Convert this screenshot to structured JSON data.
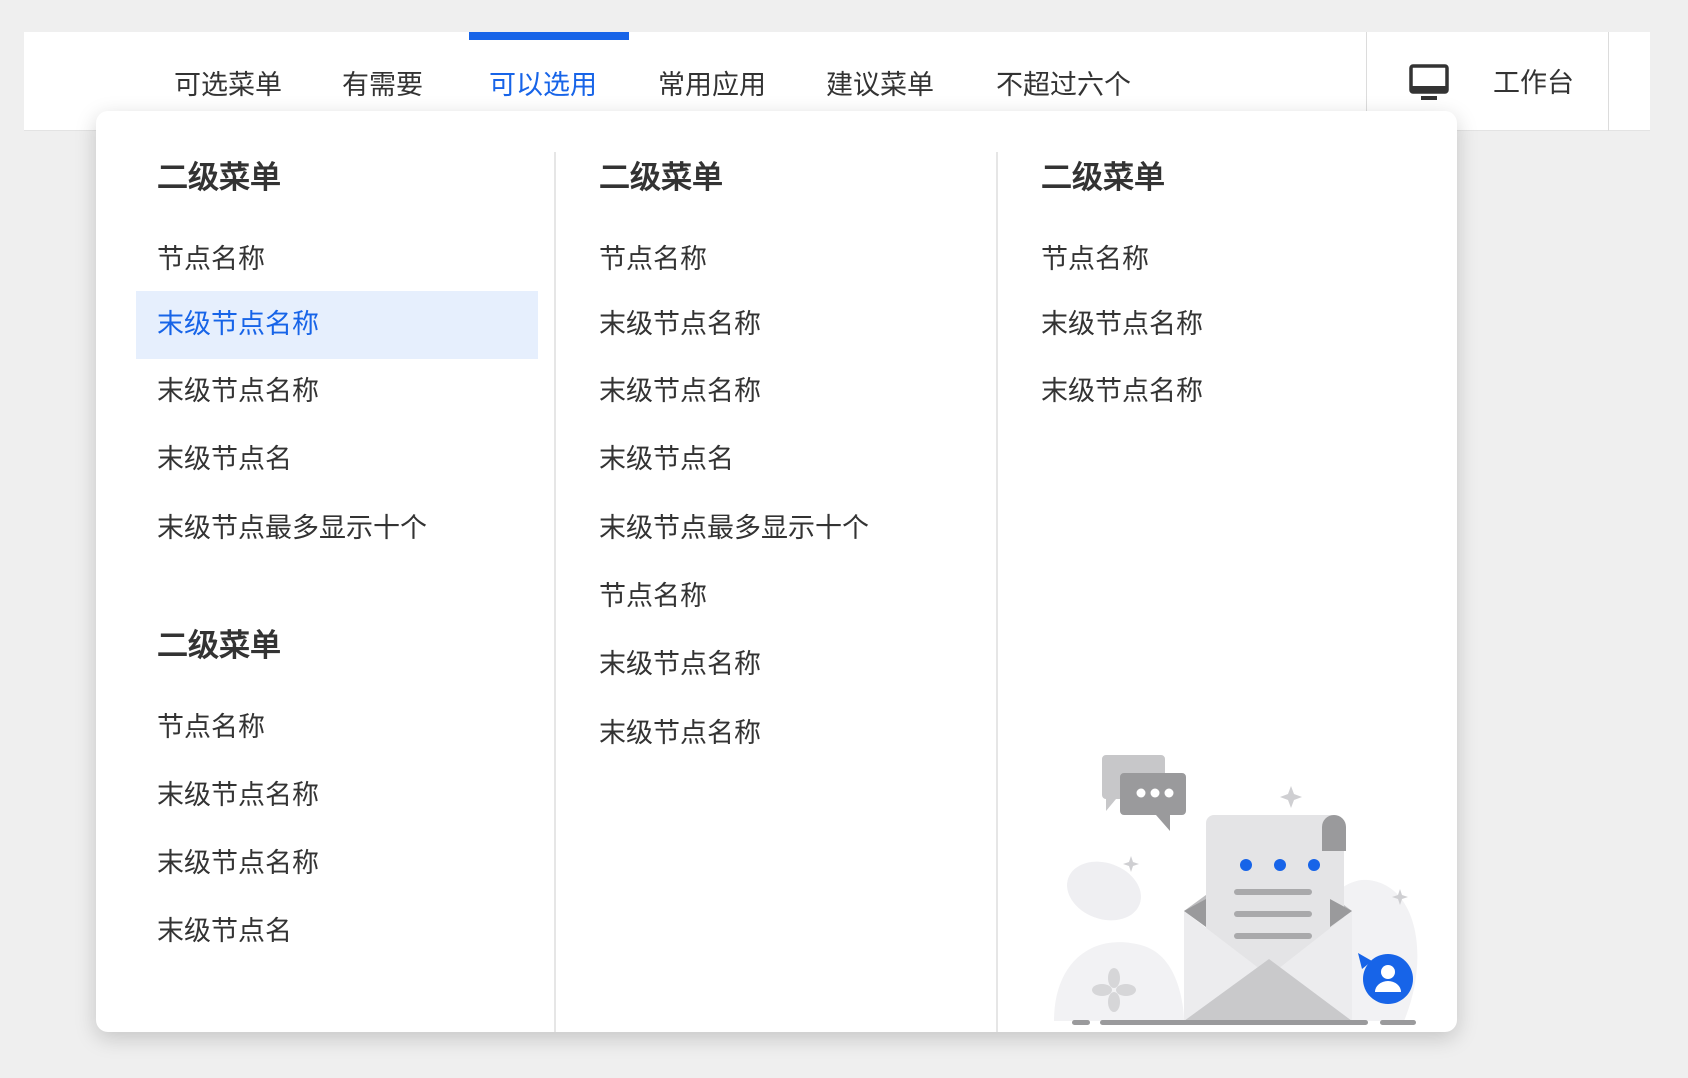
{
  "nav": {
    "tabs": [
      {
        "label": "可选菜单"
      },
      {
        "label": "有需要"
      },
      {
        "label": "可以选用"
      },
      {
        "label": "常用应用"
      },
      {
        "label": "建议菜单"
      },
      {
        "label": "不超过六个"
      }
    ],
    "active_index": 2,
    "workbench": {
      "label": "工作台",
      "icon": "monitor-icon"
    }
  },
  "menu": {
    "columns": [
      {
        "groups": [
          {
            "title": "二级菜单",
            "items": [
              "节点名称",
              "末级节点名称",
              "末级节点名称",
              "末级节点名",
              "末级节点最多显示十个"
            ]
          },
          {
            "title": "二级菜单",
            "items": [
              "节点名称",
              "末级节点名称",
              "末级节点名称",
              "末级节点名"
            ]
          }
        ]
      },
      {
        "groups": [
          {
            "title": "二级菜单",
            "items": [
              "节点名称",
              "末级节点名称",
              "末级节点名称",
              "末级节点名",
              "末级节点最多显示十个",
              "节点名称",
              "末级节点名称",
              "末级节点名称"
            ]
          }
        ]
      },
      {
        "groups": [
          {
            "title": "二级菜单",
            "items": [
              "节点名称",
              "末级节点名称",
              "末级节点名称"
            ]
          }
        ]
      }
    ],
    "highlighted_item": "columns.0.groups.0.items.1"
  },
  "colors": {
    "accent": "#1764e8",
    "highlight_bg": "#e6effd",
    "text": "#333333",
    "page_bg": "#efefef"
  },
  "illustration": {
    "icon": "envelope-message-illustration"
  }
}
